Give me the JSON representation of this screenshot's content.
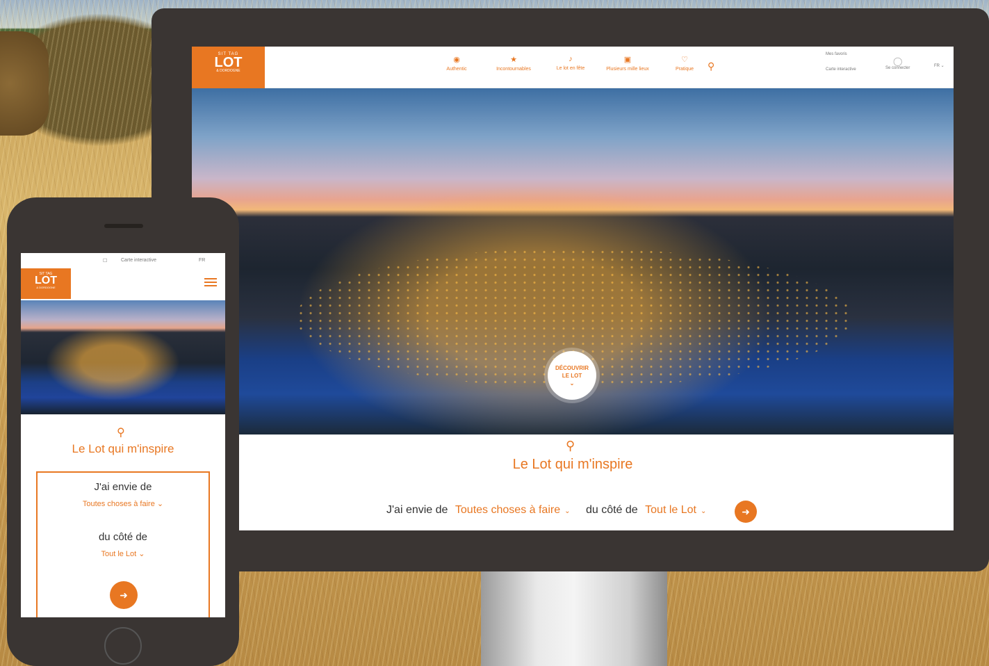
{
  "desktop": {
    "logo": {
      "small": "SIT TAG",
      "big": "LOT",
      "sub": "& DORDOGNE"
    },
    "nav": [
      {
        "icon": "eye-icon",
        "glyph": "◉",
        "label": "Authentic"
      },
      {
        "icon": "star-icon",
        "glyph": "★",
        "label": "Incontournables"
      },
      {
        "icon": "music-icon",
        "glyph": "♪",
        "label": "Le lot en fête"
      },
      {
        "icon": "camera-icon",
        "glyph": "▣",
        "label": "Plusieurs mille lieux"
      },
      {
        "icon": "heart-icon",
        "glyph": "♡",
        "label": "Pratique"
      }
    ],
    "right": {
      "line1": "Mes favoris",
      "line2": "Carte interactive",
      "connect": "Se connecter",
      "lang": "FR"
    },
    "badge": {
      "line1": "DÉCOUVRIR",
      "line2": "LE LOT"
    },
    "title": "Le Lot qui m'inspire",
    "search": {
      "label1": "J'ai envie de",
      "value1": "Toutes choses à faire",
      "label2": "du côté de",
      "value2": "Tout le Lot"
    }
  },
  "mobile": {
    "topbar": {
      "map": "Carte interactive",
      "lang": "FR"
    },
    "logo": {
      "small": "SIT TAG",
      "big": "LOT",
      "sub": "& DORDOGNE"
    },
    "title": "Le Lot qui m'inspire",
    "label1": "J'ai envie de",
    "value1": "Toutes choses à faire",
    "label2": "du côté de",
    "value2": "Tout le Lot"
  },
  "colors": {
    "accent": "#e87722",
    "bezel": "#3a3533"
  }
}
